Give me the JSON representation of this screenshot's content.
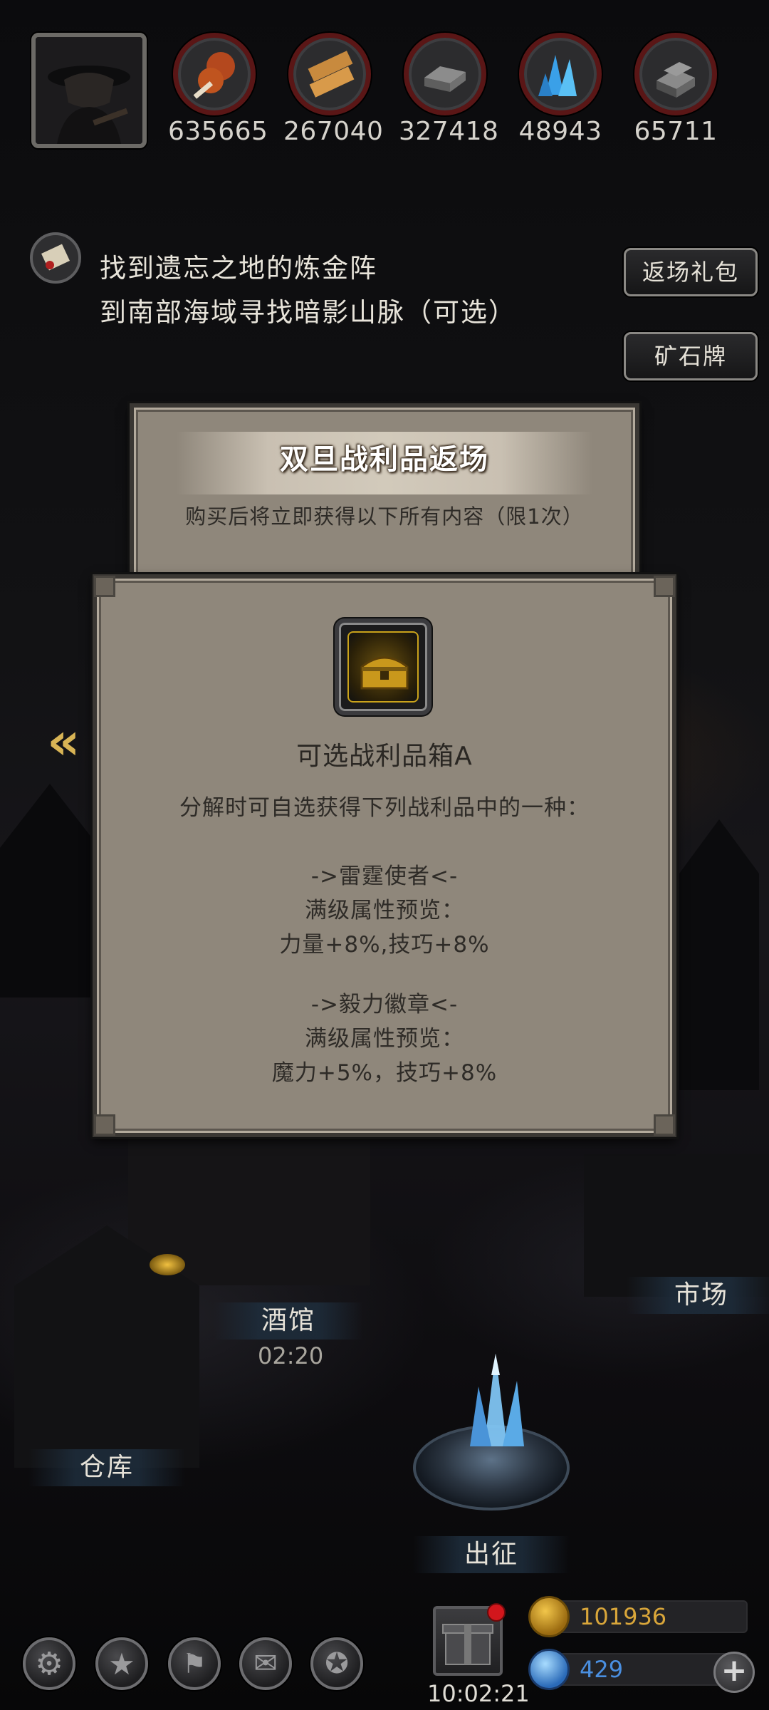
{
  "resources": [
    {
      "icon": "meat-icon",
      "value": "635665"
    },
    {
      "icon": "wood-planks-icon",
      "value": "267040"
    },
    {
      "icon": "iron-ingot-icon",
      "value": "327418"
    },
    {
      "icon": "blue-crystal-icon",
      "value": "48943"
    },
    {
      "icon": "stone-icon",
      "value": "65711"
    }
  ],
  "quest": {
    "line1": "找到遗忘之地的炼金阵",
    "line2": "到南部海域寻找暗影山脉（可选）"
  },
  "side_buttons": {
    "return_gift": "返场礼包",
    "ore_sign": "矿石牌"
  },
  "offer_panel": {
    "title": "双旦战利品返场",
    "subtitle": "购买后将立即获得以下所有内容（限1次）"
  },
  "item_panel": {
    "item_name": "可选战利品箱A",
    "description": "分解时可自选获得下列战利品中的一种：",
    "options": [
      {
        "name": "->雷霆使者<-",
        "label": "满级属性预览：",
        "stats": "力量+8%,技巧+8%"
      },
      {
        "name": "->毅力徽章<-",
        "label": "满级属性预览：",
        "stats": "魔力+5%，技巧+8%"
      }
    ]
  },
  "town": {
    "tavern": "酒馆",
    "tavern_timer": "02:20",
    "market": "市场",
    "warehouse": "仓库",
    "expedition": "出征"
  },
  "bottom": {
    "clock": "10:02:21",
    "gold": "101936",
    "gems": "429",
    "plus": "+"
  },
  "colors": {
    "gold_text": "#d9a63a",
    "gem_text": "#4a8fe0",
    "resource_ring": "#5a1616"
  }
}
